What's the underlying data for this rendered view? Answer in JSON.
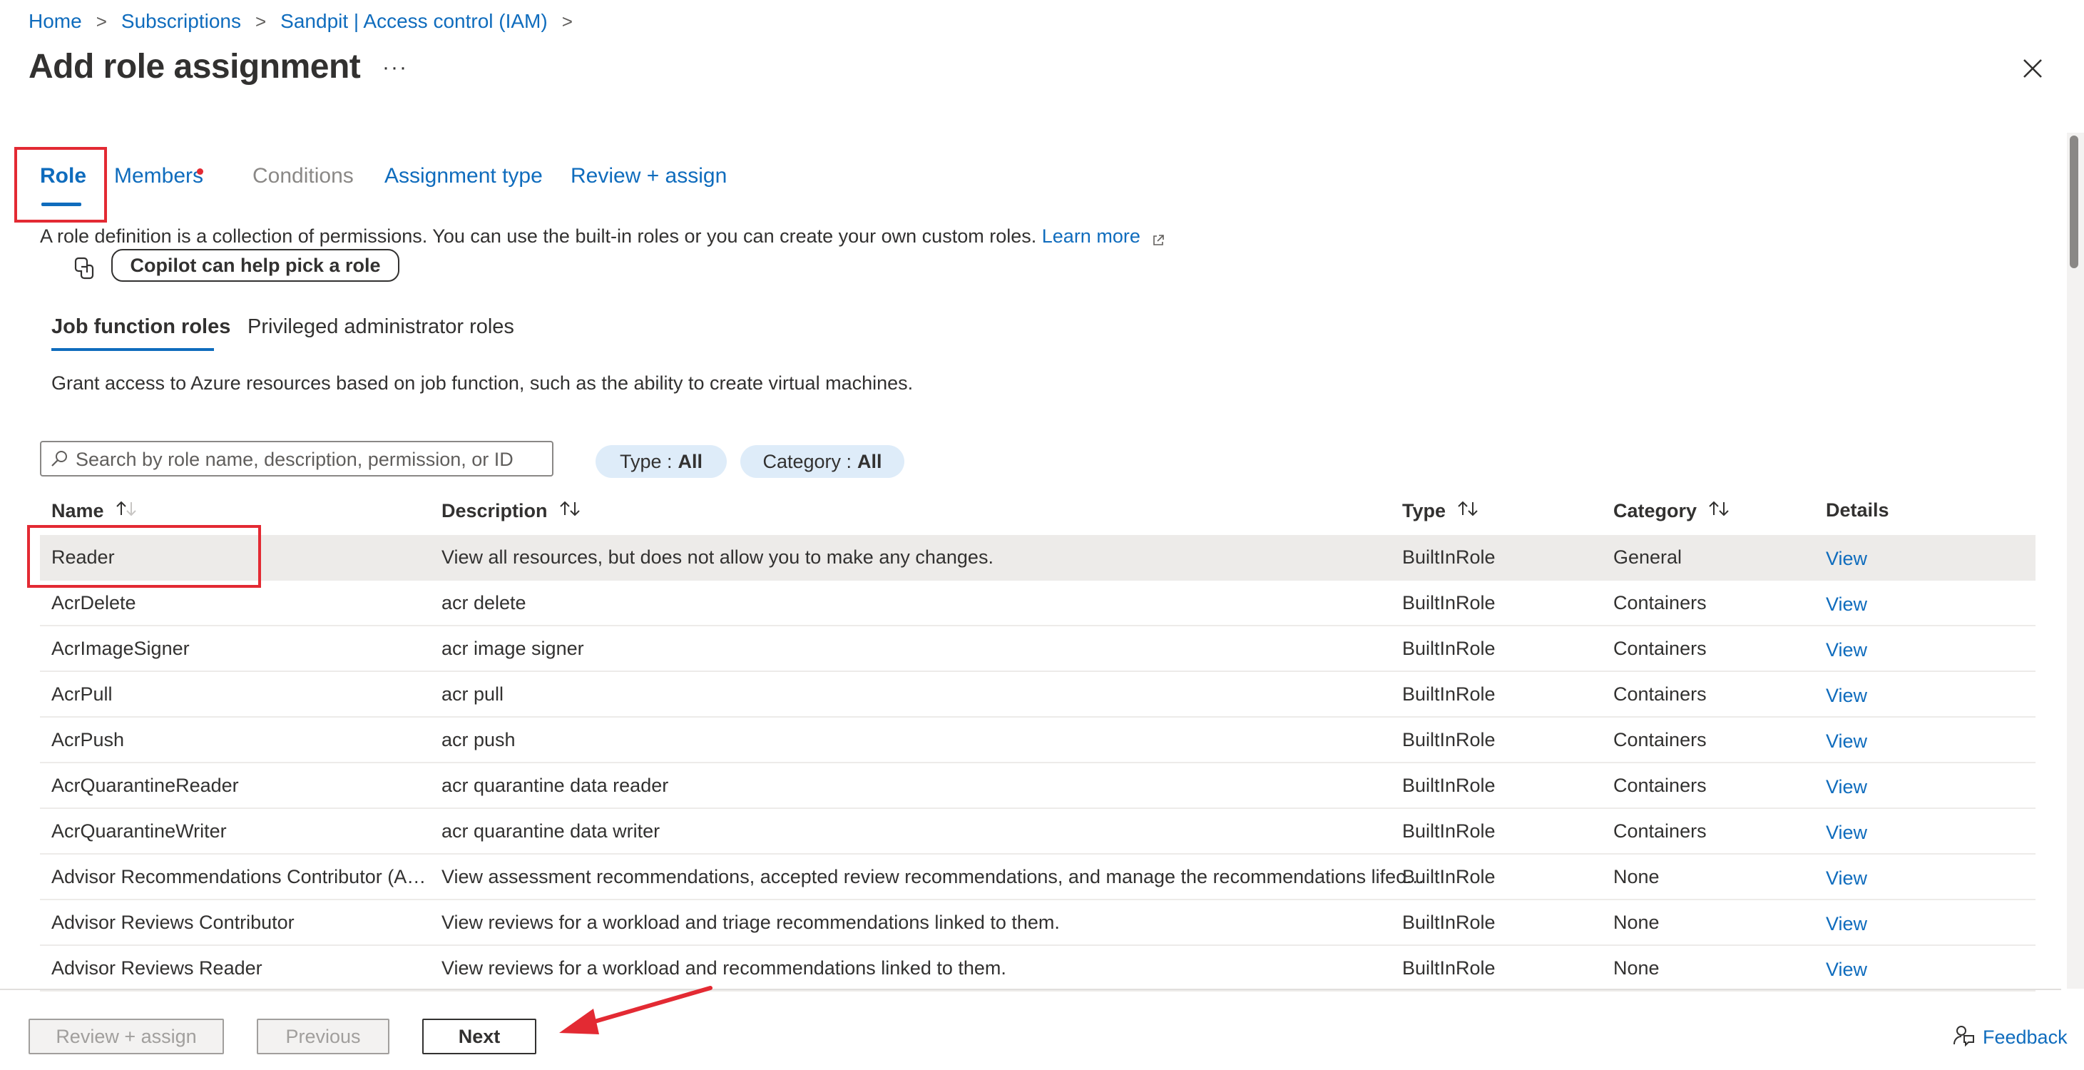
{
  "breadcrumb": {
    "items": [
      "Home",
      "Subscriptions",
      "Sandpit | Access control (IAM)"
    ],
    "separator": ">"
  },
  "page": {
    "title": "Add role assignment",
    "more_label": "···"
  },
  "tabs": [
    {
      "label": "Role",
      "state": "active"
    },
    {
      "label": "Members",
      "state": "required"
    },
    {
      "label": "Conditions",
      "state": "disabled"
    },
    {
      "label": "Assignment type",
      "state": "enabled"
    },
    {
      "label": "Review + assign",
      "state": "enabled"
    }
  ],
  "role_tab": {
    "description": "A role definition is a collection of permissions. You can use the built-in roles or you can create your own custom roles.",
    "learn_more": "Learn more",
    "copilot_button": "Copilot can help pick a role",
    "subtabs": [
      "Job function roles",
      "Privileged administrator roles"
    ],
    "subtab_description": "Grant access to Azure resources based on job function, such as the ability to create virtual machines."
  },
  "search": {
    "placeholder": "Search by role name, description, permission, or ID",
    "value": ""
  },
  "filters": [
    {
      "label": "Type :",
      "value": "All"
    },
    {
      "label": "Category :",
      "value": "All"
    }
  ],
  "table": {
    "columns": [
      "Name",
      "Description",
      "Type",
      "Category",
      "Details"
    ],
    "rows": [
      {
        "name": "Reader",
        "description": "View all resources, but does not allow you to make any changes.",
        "type": "BuiltInRole",
        "category": "General",
        "details": "View",
        "selected": true
      },
      {
        "name": "AcrDelete",
        "description": "acr delete",
        "type": "BuiltInRole",
        "category": "Containers",
        "details": "View"
      },
      {
        "name": "AcrImageSigner",
        "description": "acr image signer",
        "type": "BuiltInRole",
        "category": "Containers",
        "details": "View"
      },
      {
        "name": "AcrPull",
        "description": "acr pull",
        "type": "BuiltInRole",
        "category": "Containers",
        "details": "View"
      },
      {
        "name": "AcrPush",
        "description": "acr push",
        "type": "BuiltInRole",
        "category": "Containers",
        "details": "View"
      },
      {
        "name": "AcrQuarantineReader",
        "description": "acr quarantine data reader",
        "type": "BuiltInRole",
        "category": "Containers",
        "details": "View"
      },
      {
        "name": "AcrQuarantineWriter",
        "description": "acr quarantine data writer",
        "type": "BuiltInRole",
        "category": "Containers",
        "details": "View"
      },
      {
        "name": "Advisor Recommendations Contributor (Ass...",
        "description": "View assessment recommendations, accepted review recommendations, and manage the recommendations lifecy...",
        "type": "BuiltInRole",
        "category": "None",
        "details": "View"
      },
      {
        "name": "Advisor Reviews Contributor",
        "description": "View reviews for a workload and triage recommendations linked to them.",
        "type": "BuiltInRole",
        "category": "None",
        "details": "View"
      },
      {
        "name": "Advisor Reviews Reader",
        "description": "View reviews for a workload and recommendations linked to them.",
        "type": "BuiltInRole",
        "category": "None",
        "details": "View"
      }
    ]
  },
  "footer": {
    "review_assign": "Review + assign",
    "previous": "Previous",
    "next": "Next",
    "feedback": "Feedback"
  },
  "colors": {
    "accent": "#0f6cbd",
    "annotation": "#e32a33",
    "selected_row": "#edebe9",
    "filter_pill": "#deecf9"
  },
  "icons": {
    "close": "close-icon",
    "search": "search-icon",
    "copilot": "copilot-icon",
    "external": "external-link-icon",
    "feedback": "feedback-icon"
  }
}
